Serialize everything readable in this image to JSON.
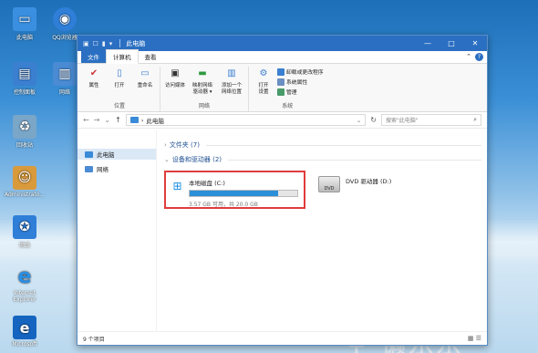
{
  "desktop": {
    "icons": [
      {
        "label": "此电脑",
        "glyph": "▭",
        "color": "#3b8fe0"
      },
      {
        "label": "QQ浏览器",
        "glyph": "◉",
        "color": "#2f7ed8"
      },
      {
        "label": "控制面板",
        "glyph": "▤",
        "color": "#3b7fd0"
      },
      {
        "label": "网络",
        "glyph": "▥",
        "color": "#4a8bd4"
      },
      {
        "label": "回收站",
        "glyph": "♻",
        "color": "#7aa6c8"
      },
      {
        "label": "Administrato...",
        "glyph": "☺",
        "color": "#d99a3c"
      },
      {
        "label": "网络",
        "glyph": "✪",
        "color": "#2f7ed8"
      },
      {
        "label": "Internet Explorer",
        "glyph": "e",
        "color": "#2a8fe3"
      },
      {
        "label": "Microsoft",
        "glyph": "e",
        "color": "#1565c0"
      }
    ],
    "watermark": "+ 懒乐乐"
  },
  "window": {
    "title": "此电脑",
    "controls": {
      "minimize": "—",
      "maximize": "□",
      "close": "✕"
    },
    "tabs": [
      "文件",
      "计算机",
      "查看"
    ],
    "help": "?",
    "ribbon": {
      "groups": [
        {
          "label": "位置",
          "buttons": [
            "属性",
            "打开",
            "重命名"
          ]
        },
        {
          "label": "网络",
          "buttons": [
            "访问媒体",
            "映射网络\n驱动器 ▾",
            "添加一个\n网络位置"
          ]
        },
        {
          "label": "系统",
          "buttons": [
            "打开\n设置"
          ],
          "small": [
            "卸载或更改程序",
            "系统属性",
            "管理"
          ]
        }
      ]
    },
    "address": {
      "path": "此电脑",
      "search_placeholder": "搜索\"此电脑\""
    },
    "nav": [
      {
        "label": "此电脑",
        "color": "#3a8ad8"
      },
      {
        "label": "网络",
        "color": "#4a8bd4"
      }
    ],
    "sections": {
      "folders": "文件夹 (7)",
      "drives": "设备和驱动器 (2)"
    },
    "drives": [
      {
        "name": "本地磁盘 (C:)",
        "size": "3.57 GB 可用，共 20.0 GB",
        "used_fraction": 0.82
      },
      {
        "name": "DVD 驱动器 (D:)",
        "dvd_label": "DVD"
      }
    ],
    "status": {
      "items": "9 个项目",
      "views": "▦ ☰"
    }
  }
}
